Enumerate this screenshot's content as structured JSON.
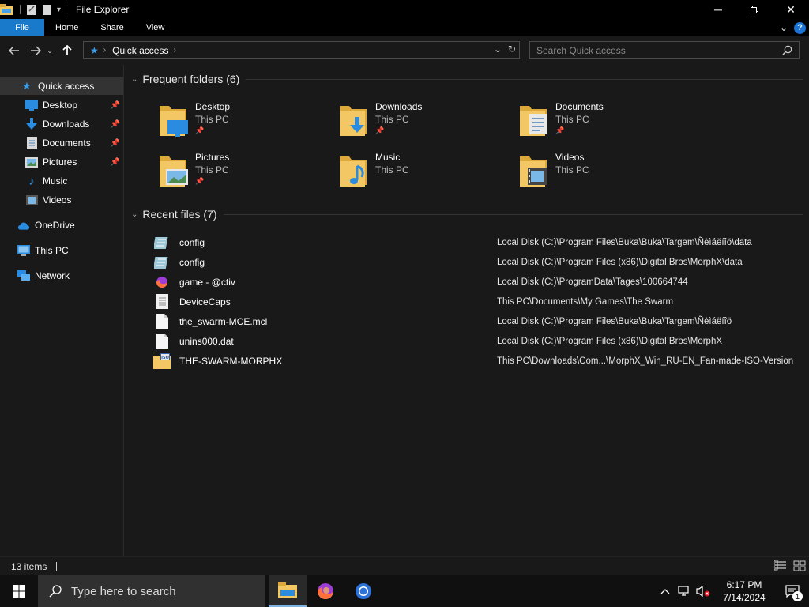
{
  "window": {
    "title": "File Explorer"
  },
  "ribbon": {
    "tabs": [
      "File",
      "Home",
      "Share",
      "View"
    ]
  },
  "address": {
    "crumb": "Quick access"
  },
  "search": {
    "placeholder": "Search Quick access"
  },
  "sidebar": {
    "items": [
      {
        "label": "Quick access",
        "icon": "star-icon"
      },
      {
        "label": "Desktop",
        "icon": "desktop-icon",
        "pinned": true
      },
      {
        "label": "Downloads",
        "icon": "download-arrow-icon",
        "pinned": true
      },
      {
        "label": "Documents",
        "icon": "document-icon",
        "pinned": true
      },
      {
        "label": "Pictures",
        "icon": "picture-icon",
        "pinned": true
      },
      {
        "label": "Music",
        "icon": "music-note-icon"
      },
      {
        "label": "Videos",
        "icon": "video-icon"
      },
      {
        "label": "OneDrive",
        "icon": "cloud-icon"
      },
      {
        "label": "This PC",
        "icon": "monitor-icon"
      },
      {
        "label": "Network",
        "icon": "network-icon"
      }
    ]
  },
  "frequent": {
    "title": "Frequent folders (6)",
    "folders": [
      {
        "name": "Desktop",
        "location": "This PC",
        "pinned": true,
        "icon": "desktop-folder-icon"
      },
      {
        "name": "Downloads",
        "location": "This PC",
        "pinned": true,
        "icon": "downloads-folder-icon"
      },
      {
        "name": "Documents",
        "location": "This PC",
        "pinned": true,
        "icon": "documents-folder-icon"
      },
      {
        "name": "Pictures",
        "location": "This PC",
        "pinned": true,
        "icon": "pictures-folder-icon"
      },
      {
        "name": "Music",
        "location": "This PC",
        "pinned": false,
        "icon": "music-folder-icon"
      },
      {
        "name": "Videos",
        "location": "This PC",
        "pinned": false,
        "icon": "videos-folder-icon"
      }
    ]
  },
  "recent": {
    "title": "Recent files (7)",
    "files": [
      {
        "name": "config",
        "path": "Local Disk (C:)\\Program Files\\Buka\\Buka\\Targem\\Ñèìáëíîö\\data",
        "icon": "config-file-icon"
      },
      {
        "name": "config",
        "path": "Local Disk (C:)\\Program Files (x86)\\Digital Bros\\MorphX\\data",
        "icon": "config-file-icon"
      },
      {
        "name": "game - @ctiv",
        "path": "Local Disk (C:)\\ProgramData\\Tages\\100664744",
        "icon": "firefox-file-icon"
      },
      {
        "name": "DeviceCaps",
        "path": "This PC\\Documents\\My Games\\The Swarm",
        "icon": "text-file-icon"
      },
      {
        "name": "the_swarm-MCE.mcl",
        "path": "Local Disk (C:)\\Program Files\\Buka\\Buka\\Targem\\Ñèìáëíîö",
        "icon": "blank-file-icon"
      },
      {
        "name": "unins000.dat",
        "path": "Local Disk (C:)\\Program Files (x86)\\Digital Bros\\MorphX",
        "icon": "blank-file-icon"
      },
      {
        "name": "THE-SWARM-MORPHX",
        "path": "This PC\\Downloads\\Com...\\MorphX_Win_RU-EN_Fan-made-ISO-Version",
        "icon": "iso-file-icon"
      }
    ]
  },
  "status": {
    "count": "13 items"
  },
  "taskbar": {
    "search_placeholder": "Type here to search",
    "time": "6:17 PM",
    "date": "7/14/2024",
    "notifications": "1"
  },
  "colors": {
    "accent": "#1979ca",
    "background": "#191919",
    "folder": "#f3c864"
  }
}
